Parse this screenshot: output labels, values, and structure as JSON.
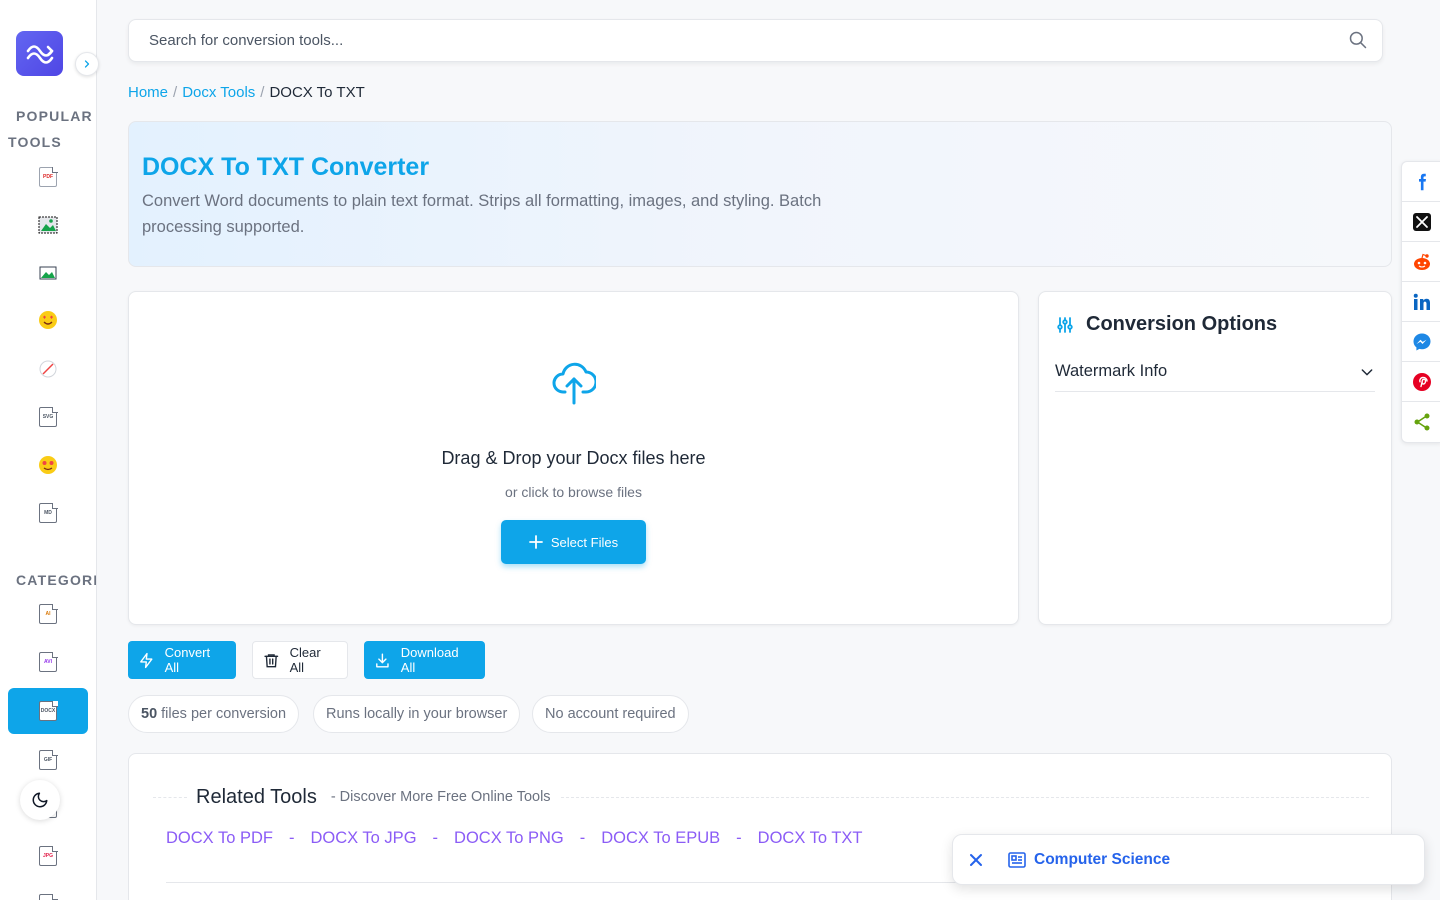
{
  "search": {
    "placeholder": "Search for conversion tools..."
  },
  "sidebar": {
    "popular_heading": "POPULAR TOOLS",
    "categories_heading": "CATEGORIES",
    "popular_items": [
      {
        "icon": "pdf-file-icon",
        "badge": "PDF"
      },
      {
        "icon": "image-frame-icon",
        "badge": ""
      },
      {
        "icon": "image-icon",
        "badge": ""
      },
      {
        "icon": "heart-eyes-emoji-icon",
        "badge": ""
      },
      {
        "icon": "slash-circle-icon",
        "badge": ""
      },
      {
        "icon": "svg-file-icon",
        "badge": "SVG"
      },
      {
        "icon": "star-eyes-emoji-icon",
        "badge": ""
      },
      {
        "icon": "md-file-icon",
        "badge": "MD"
      }
    ],
    "category_items": [
      {
        "icon": "ai-file-icon",
        "badge": "AI"
      },
      {
        "icon": "avi-file-icon",
        "badge": "AVI"
      },
      {
        "icon": "docx-file-icon",
        "badge": "DOCX",
        "active": true
      },
      {
        "icon": "gif-file-icon",
        "badge": "GIF"
      },
      {
        "icon": "file-icon",
        "badge": ""
      },
      {
        "icon": "jpg-file-icon",
        "badge": "JPG"
      }
    ]
  },
  "breadcrumb": {
    "home": "Home",
    "section": "Docx Tools",
    "current": "DOCX To TXT",
    "separator": "/"
  },
  "hero": {
    "title": "DOCX To TXT Converter",
    "description": "Convert Word documents to plain text format. Strips all formatting, images, and styling. Batch processing supported."
  },
  "dropzone": {
    "title": "Drag & Drop your Docx files here",
    "subtitle": "or click to browse files",
    "button": "Select Files"
  },
  "options": {
    "title": "Conversion Options",
    "accordion_label": "Watermark Info"
  },
  "actions": {
    "convert": "Convert All",
    "clear": "Clear All",
    "download": "Download All"
  },
  "info": {
    "files_count": "50",
    "files_text": "files per conversion",
    "local": "Runs locally in your browser",
    "account": "No account required"
  },
  "related": {
    "title": "Related Tools",
    "subtitle": "- Discover More Free Online Tools",
    "separator": "-",
    "links": [
      "DOCX To PDF",
      "DOCX To JPG",
      "DOCX To PNG",
      "DOCX To EPUB",
      "DOCX To TXT"
    ]
  },
  "share": [
    "facebook",
    "x",
    "reddit",
    "linkedin",
    "messenger",
    "pinterest",
    "sharethis"
  ],
  "toast": {
    "text": "Computer Science"
  },
  "colors": {
    "accent": "#0ea5e9",
    "link_purple": "#8b5cf6",
    "toast_blue": "#2563eb",
    "brand": "#4f46e5"
  }
}
